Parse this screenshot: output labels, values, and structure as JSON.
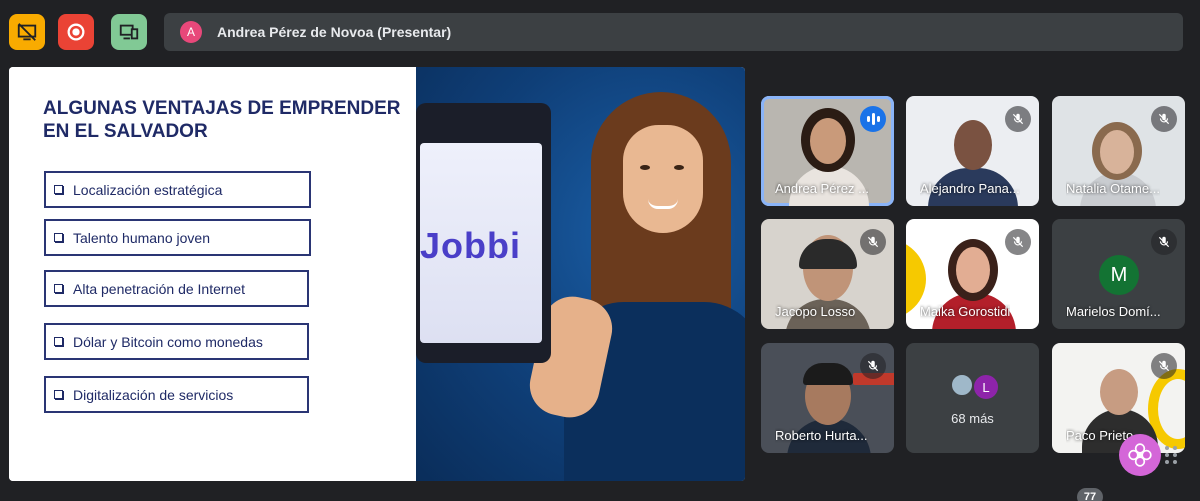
{
  "toolbar": {
    "no_screen_share_icon": "screen-share-off-icon",
    "record_icon": "record-icon",
    "present_icon": "present-devices-icon",
    "colors": {
      "amber": "#f9ab00",
      "red": "#ea4335",
      "green": "#81c995"
    }
  },
  "presenter": {
    "avatar_letter": "A",
    "label": "Andrea Pérez de Novoa (Presentar)"
  },
  "slide": {
    "title": "ALGUNAS VENTAJAS DE EMPRENDER EN EL SALVADOR",
    "items": [
      "Localización estratégica",
      "Talento humano joven",
      "Alta penetración de Internet",
      "Dólar y Bitcoin como monedas",
      "Digitalización de servicios"
    ],
    "phone_brand": "Jobbi"
  },
  "participants": [
    {
      "name": "Andrea Pérez de Novoa",
      "display": "Andrea Pérez ...",
      "state": "speaking"
    },
    {
      "name": "Alejandro Panameño",
      "display": "Alejandro Pana...",
      "state": "muted"
    },
    {
      "name": "Natalia Otamendi",
      "display": "Natalia Otame...",
      "state": "muted"
    },
    {
      "name": "Jacopo Losso",
      "display": "Jacopo Losso",
      "state": "muted"
    },
    {
      "name": "Maika Gorostidi",
      "display": "Maika Gorostidi",
      "state": "muted"
    },
    {
      "name": "Marielos Domínguez",
      "display": "Marielos Domí...",
      "state": "muted",
      "avatar_letter": "M"
    },
    {
      "name": "Roberto Hurtado",
      "display": "Roberto Hurta...",
      "state": "muted"
    },
    {
      "name": "Paco Prieto",
      "display": "Paco Prieto",
      "state": "muted"
    }
  ],
  "more_tile": {
    "avatar_letter": "L",
    "label": "68 más"
  },
  "badge_count": "77"
}
